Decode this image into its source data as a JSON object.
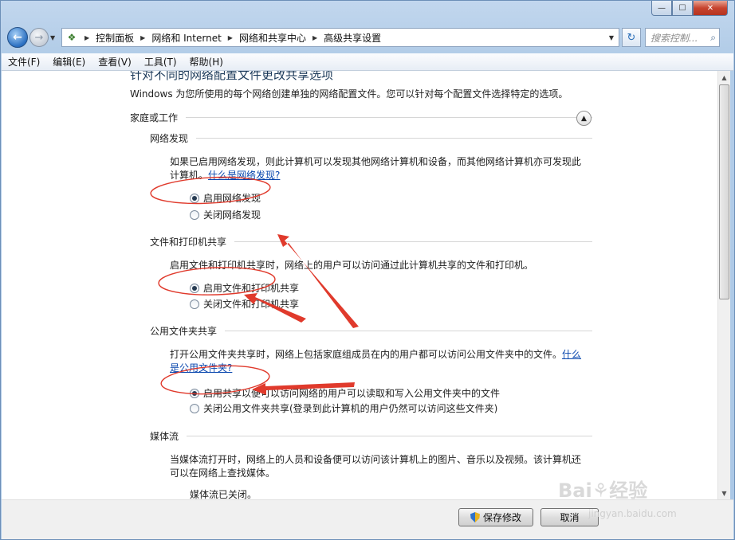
{
  "window": {
    "caption_buttons": {
      "minimize": "—",
      "maximize": "☐",
      "close": "✕"
    }
  },
  "nav": {
    "back_icon": "back-arrow-icon",
    "forward_icon": "forward-arrow-icon",
    "breadcrumb": [
      "控制面板",
      "网络和 Internet",
      "网络和共享中心",
      "高级共享设置"
    ],
    "search_placeholder": "搜索控制..."
  },
  "menu": [
    "文件(F)",
    "编辑(E)",
    "查看(V)",
    "工具(T)",
    "帮助(H)"
  ],
  "content": {
    "page_title": "针对不同的网络配置文件更改共享选项",
    "intro": "Windows 为您所使用的每个网络创建单独的网络配置文件。您可以针对每个配置文件选择特定的选项。",
    "group_label": "家庭或工作",
    "sections": [
      {
        "label": "网络发现",
        "desc": "如果已启用网络发现，则此计算机可以发现其他网络计算机和设备，而其他网络计算机亦可发现此计算机。",
        "link": "什么是网络发现?",
        "options": [
          {
            "label": "启用网络发现",
            "selected": true
          },
          {
            "label": "关闭网络发现",
            "selected": false
          }
        ]
      },
      {
        "label": "文件和打印机共享",
        "desc": "启用文件和打印机共享时，网络上的用户可以访问通过此计算机共享的文件和打印机。",
        "options": [
          {
            "label": "启用文件和打印机共享",
            "selected": true
          },
          {
            "label": "关闭文件和打印机共享",
            "selected": false
          }
        ]
      },
      {
        "label": "公用文件夹共享",
        "desc": "打开公用文件夹共享时，网络上包括家庭组成员在内的用户都可以访问公用文件夹中的文件。",
        "link": "什么是公用文件夹?",
        "options": [
          {
            "label": "启用共享以便可以访问网络的用户可以读取和写入公用文件夹中的文件",
            "selected": true
          },
          {
            "label": "关闭公用文件夹共享(登录到此计算机的用户仍然可以访问这些文件夹)",
            "selected": false
          }
        ]
      },
      {
        "label": "媒体流",
        "desc": "当媒体流打开时，网络上的人员和设备便可以访问该计算机上的图片、音乐以及视频。该计算机还可以在网络上查找媒体。",
        "status": "媒体流已关闭。"
      }
    ]
  },
  "footer": {
    "save_label": "保存修改",
    "cancel_label": "取消"
  },
  "watermark": {
    "brand": "Bai",
    "brand2": "经验",
    "url": "jingyan.baidu.com"
  },
  "colors": {
    "annotation": "#e03a2c",
    "link": "#0645ad"
  }
}
